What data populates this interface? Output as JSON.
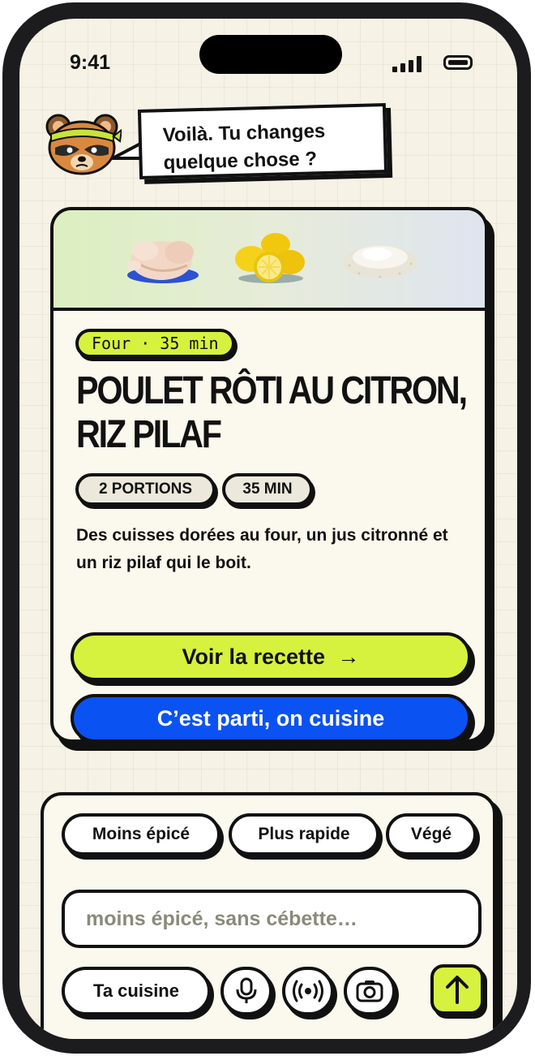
{
  "status_bar": {
    "time": "9:41"
  },
  "assistant": {
    "message": "Voilà. Tu changes quelque chose ?"
  },
  "recipe": {
    "meta_chip": "Four · 35 min",
    "title": "POULET RÔTI AU CITRON, RIZ PILAF",
    "tags": [
      "2 PORTIONS",
      "35 MIN"
    ],
    "description": "Des cuisses dorées au four, un jus citronné et un riz pilaf qui le boit.",
    "ingredients": [
      "chicken",
      "lemons",
      "rice"
    ],
    "view_label": "Voir la recette",
    "view_arrow": "→",
    "cook_label": "C’est parti, on cuisine"
  },
  "composer": {
    "suggestions": [
      "Moins épicé",
      "Plus rapide",
      "Végé"
    ],
    "placeholder": "moins épicé, sans cébette…",
    "value": "",
    "kitchen_label": "Ta cuisine",
    "tools": [
      "mic-icon",
      "broadcast-icon",
      "camera-icon"
    ],
    "send_icon": "arrow-up-icon"
  },
  "colors": {
    "lime": "#d6f23e",
    "blue": "#0a52f2",
    "background": "#f6f2e5",
    "ink": "#111111"
  }
}
